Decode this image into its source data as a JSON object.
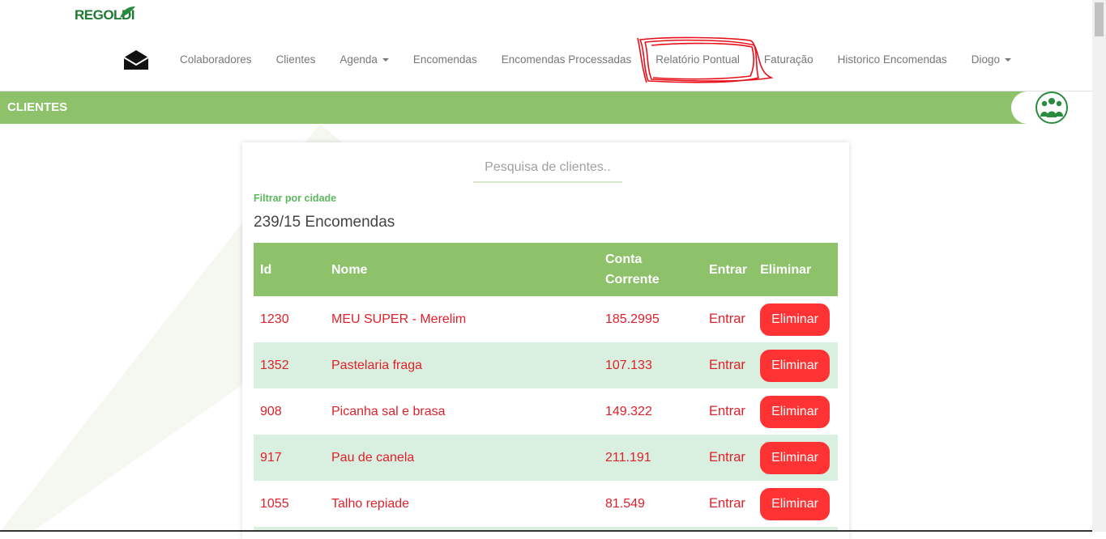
{
  "brand": {
    "logo_text": "REGOLDI"
  },
  "nav": {
    "items": [
      {
        "label": "Colaboradores",
        "dropdown": false
      },
      {
        "label": "Clientes",
        "dropdown": false
      },
      {
        "label": "Agenda",
        "dropdown": true
      },
      {
        "label": "Encomendas",
        "dropdown": false
      },
      {
        "label": "Encomendas Processadas",
        "dropdown": false
      },
      {
        "label": "Relatório Pontual",
        "dropdown": false
      },
      {
        "label": "Faturação",
        "dropdown": false
      },
      {
        "label": "Historico Encomendas",
        "dropdown": false
      },
      {
        "label": "Diogo",
        "dropdown": true
      }
    ]
  },
  "section": {
    "title": "CLIENTES",
    "icon": "people-group-icon"
  },
  "search": {
    "placeholder": "Pesquisa de clientes.."
  },
  "filter": {
    "label": "Filtrar por cidade"
  },
  "summary": {
    "count_text": "239/15 Encomendas"
  },
  "table": {
    "headers": {
      "id": "Id",
      "nome": "Nome",
      "conta": "Conta Corrente",
      "entrar": "Entrar",
      "eliminar": "Eliminar"
    },
    "rows": [
      {
        "id": "1230",
        "nome": "MEU SUPER - Merelim",
        "conta": "185.2995",
        "entrar": "Entrar",
        "eliminar": "Eliminar"
      },
      {
        "id": "1352",
        "nome": "Pastelaria fraga",
        "conta": "107.133",
        "entrar": "Entrar",
        "eliminar": "Eliminar"
      },
      {
        "id": "908",
        "nome": "Picanha sal e brasa",
        "conta": "149.322",
        "entrar": "Entrar",
        "eliminar": "Eliminar"
      },
      {
        "id": "917",
        "nome": "Pau de canela",
        "conta": "211.191",
        "entrar": "Entrar",
        "eliminar": "Eliminar"
      },
      {
        "id": "1055",
        "nome": "Talho repiade",
        "conta": "81.549",
        "entrar": "Entrar",
        "eliminar": "Eliminar"
      }
    ]
  },
  "colors": {
    "accent_green": "#8dc26b",
    "row_alt": "#d9efdf",
    "text_red": "#e0212b",
    "button_red": "#ff3333",
    "annotation_red": "#e8101a"
  }
}
